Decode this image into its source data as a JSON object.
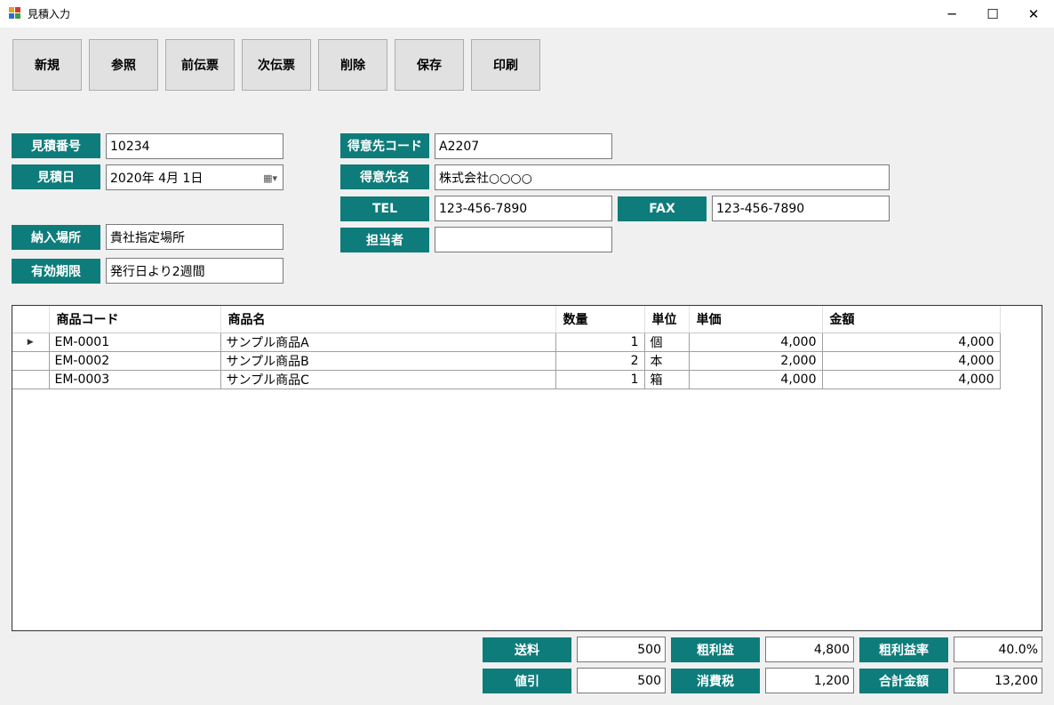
{
  "window": {
    "title": "見積入力",
    "minimize_glyph": "─",
    "maximize_glyph": "☐",
    "close_glyph": "✕"
  },
  "toolbar": [
    "新規",
    "参照",
    "前伝票",
    "次伝票",
    "削除",
    "保存",
    "印刷"
  ],
  "header": {
    "quote_no": {
      "label": "見積番号",
      "value": "10234"
    },
    "quote_date": {
      "label": "見積日",
      "value": "2020年  4月  1日"
    },
    "delivery_place": {
      "label": "納入場所",
      "value": "貴社指定場所"
    },
    "valid_period": {
      "label": "有効期限",
      "value": "発行日より2週間"
    },
    "customer_code": {
      "label": "得意先コード",
      "value": "A2207"
    },
    "customer_name": {
      "label": "得意先名",
      "value": "株式会社○○○○"
    },
    "tel": {
      "label": "TEL",
      "value": "123-456-7890"
    },
    "fax": {
      "label": "FAX",
      "value": "123-456-7890"
    },
    "person": {
      "label": "担当者",
      "value": ""
    }
  },
  "grid": {
    "columns": [
      "商品コード",
      "商品名",
      "数量",
      "単位",
      "単価",
      "金額"
    ],
    "current_row_marker": "▶",
    "rows": [
      {
        "code": "EM-0001",
        "name": "サンプル商品A",
        "qty": "1",
        "unit": "個",
        "price": "4,000",
        "amount": "4,000"
      },
      {
        "code": "EM-0002",
        "name": "サンプル商品B",
        "qty": "2",
        "unit": "本",
        "price": "2,000",
        "amount": "4,000"
      },
      {
        "code": "EM-0003",
        "name": "サンプル商品C",
        "qty": "1",
        "unit": "箱",
        "price": "4,000",
        "amount": "4,000"
      }
    ]
  },
  "totals": {
    "shipping": {
      "label": "送料",
      "value": "500"
    },
    "discount": {
      "label": "値引",
      "value": "500"
    },
    "gross_profit": {
      "label": "粗利益",
      "value": "4,800"
    },
    "tax": {
      "label": "消費税",
      "value": "1,200"
    },
    "gross_margin": {
      "label": "粗利益率",
      "value": "40.0%"
    },
    "total": {
      "label": "合計金額",
      "value": "13,200"
    }
  },
  "colors": {
    "label_bg": "#0e7c7b",
    "label_text": "#ffffff"
  }
}
